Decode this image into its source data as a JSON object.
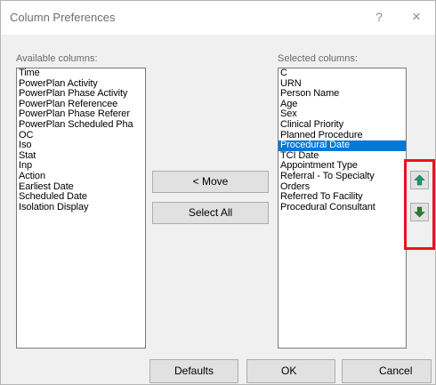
{
  "window": {
    "title": "Column Preferences",
    "help_glyph": "?",
    "close_glyph": "×"
  },
  "available": {
    "label": "Available columns:",
    "items": [
      "Time",
      "PowerPlan Activity",
      "PowerPlan Phase Activity",
      "PowerPlan Referencee",
      "PowerPlan Phase Referer",
      "PowerPlan Scheduled Pha",
      "OC",
      "Iso",
      "Stat",
      "Inp",
      "Action",
      "Earliest Date",
      "Scheduled Date",
      "Isolation Display"
    ]
  },
  "selected": {
    "label": "Selected columns:",
    "items": [
      "C",
      "URN",
      "Person Name",
      "Age",
      "Sex",
      "Clinical Priority",
      "Planned Procedure",
      "Procedural Date",
      "TCI Date",
      "Appointment Type",
      "Referral - To Specialty",
      "Orders",
      "Referred To Facility",
      "Procedural Consultant"
    ],
    "selected_item": "Procedural Date"
  },
  "buttons": {
    "move": "< Move",
    "select_all": "Select All",
    "defaults": "Defaults",
    "ok": "OK",
    "cancel": "Cancel"
  },
  "colors": {
    "selection": "#0078d7",
    "highlight_border": "#e8141b",
    "arrow_up": "#1f9c6b",
    "arrow_down": "#2e7d32"
  },
  "icons": {
    "up": "arrow-up-icon",
    "down": "arrow-down-icon"
  }
}
